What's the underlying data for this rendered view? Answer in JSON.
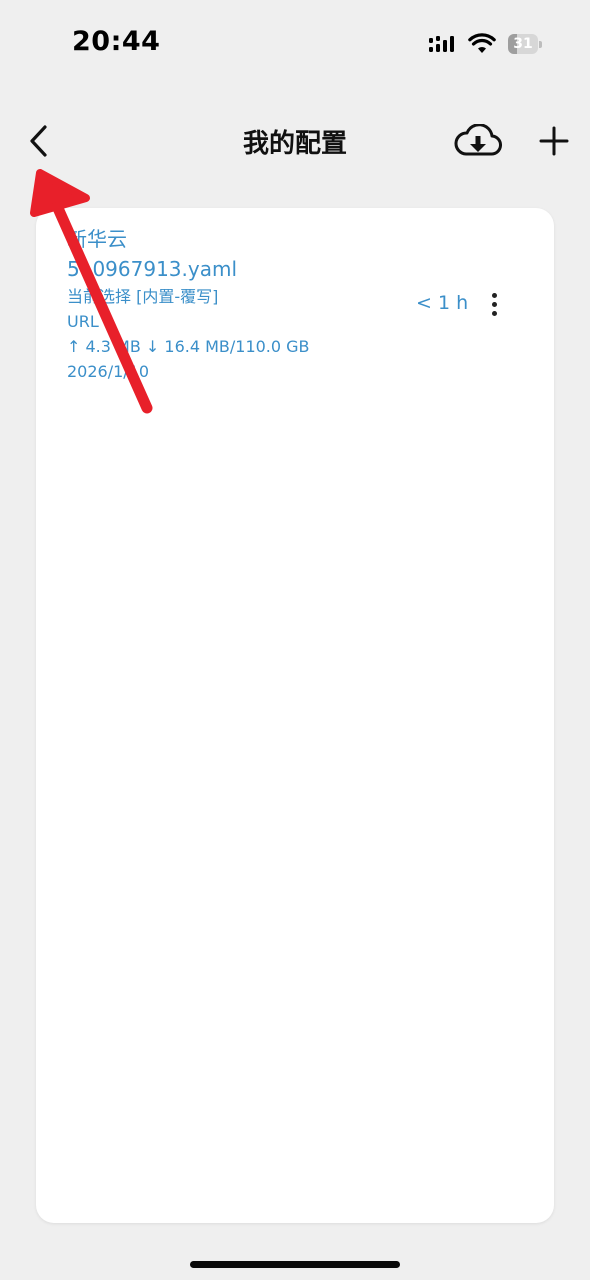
{
  "status_bar": {
    "time": "20:44",
    "battery_level": "31",
    "battery_fraction": 0.31,
    "icons": [
      "cellular-signal-icon",
      "wifi-icon",
      "battery-icon"
    ]
  },
  "header": {
    "title": "我的配置",
    "back_icon": "chevron-left-icon",
    "download_icon": "cloud-download-icon",
    "add_icon": "plus-icon"
  },
  "profiles": [
    {
      "name": "新华云",
      "file": "510967913.yaml",
      "selection": "当前选择 [内置-覆写]",
      "type": "URL",
      "traffic": "↑ 4.3 MB ↓ 16.4 MB/110.0 GB",
      "date": "2026/1/10",
      "updated": "< 1 h",
      "menu_icon": "more-vertical-icon"
    }
  ],
  "colors": {
    "background": "#efefef",
    "card": "#ffffff",
    "accent_text": "#3b8fc9",
    "annotation": "#e8202a"
  }
}
